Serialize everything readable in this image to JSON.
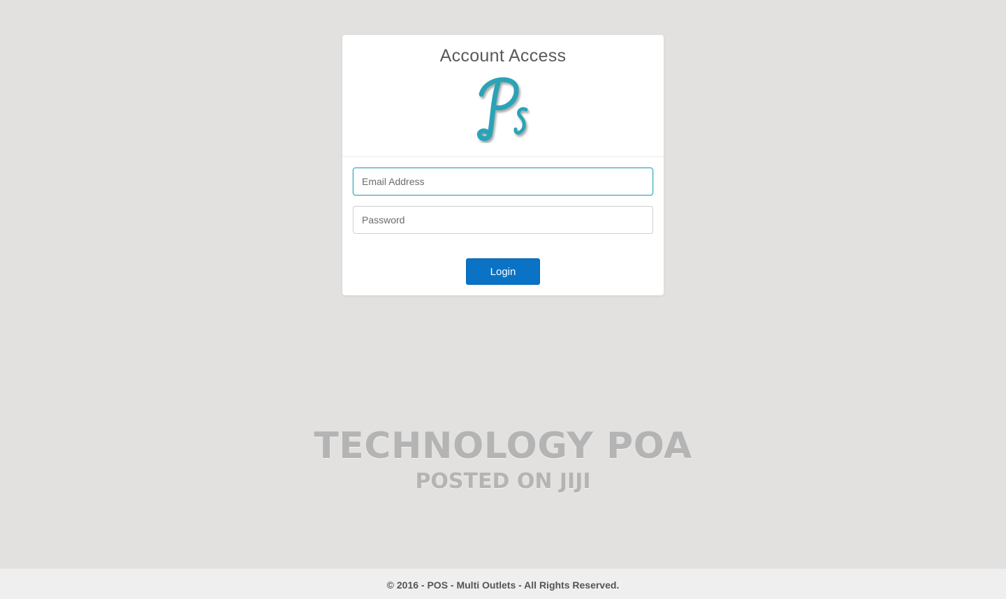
{
  "login_card": {
    "title": "Account Access",
    "logo_text": "Ps",
    "email_placeholder": "Email Address",
    "password_placeholder": "Password",
    "login_label": "Login"
  },
  "watermark": {
    "line1": "TECHNOLOGY POA",
    "line2": "POSTED ON JIJI"
  },
  "footer": {
    "text": "© 2016 - POS - Multi Outlets - All Rights Reserved."
  },
  "colors": {
    "background": "#e2e1df",
    "primary_button": "#0a73c5",
    "focus_border": "#2aa3b7",
    "logo": "#2aa3b7"
  }
}
